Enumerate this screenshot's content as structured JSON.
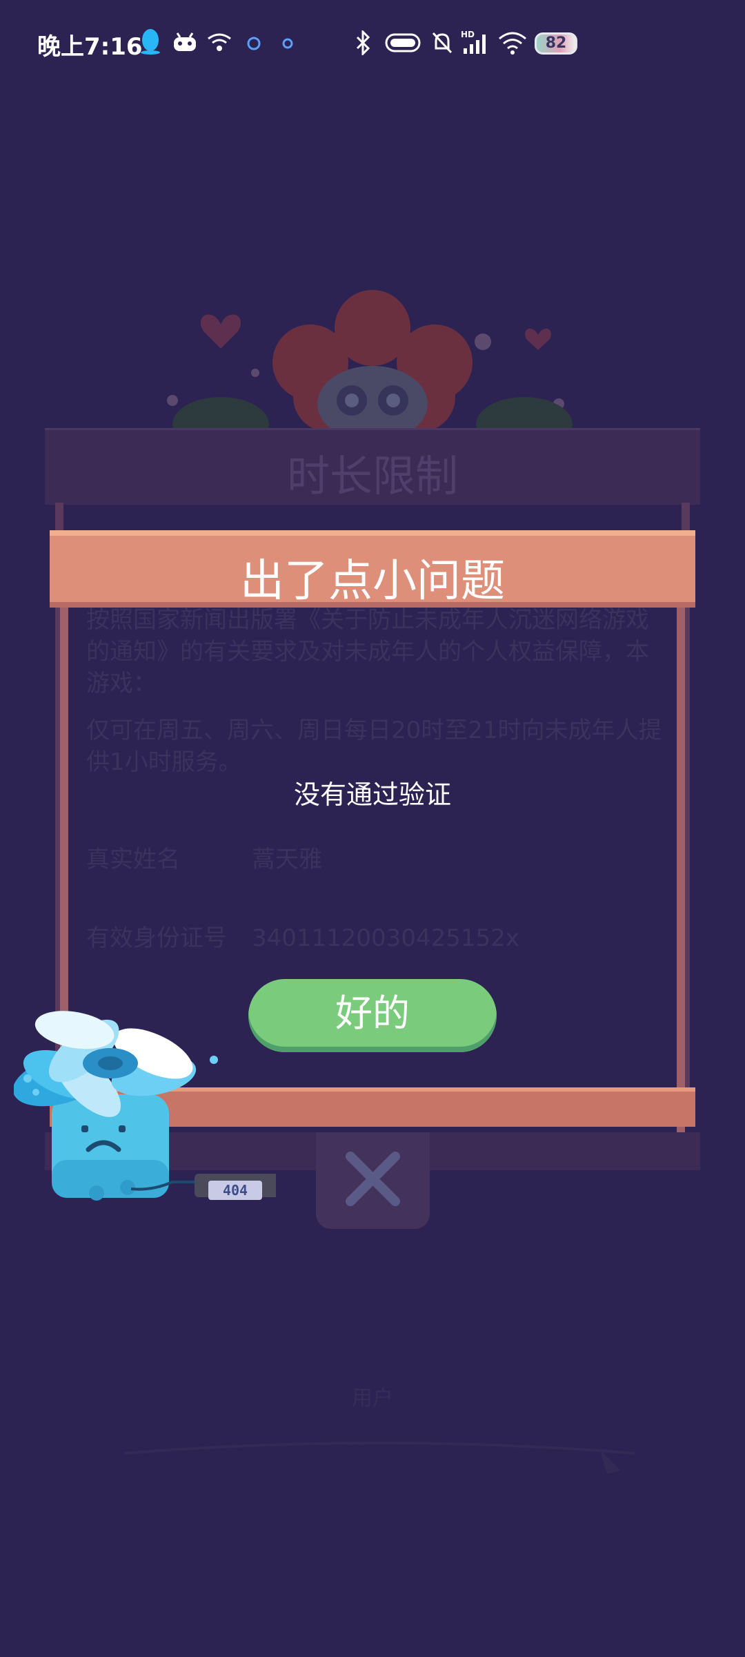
{
  "status_bar": {
    "time": "晚上7:16",
    "icons": [
      "qq-icon",
      "android-icon",
      "wifi-calling-icon",
      "app-icon",
      "app-icon",
      "bluetooth-icon",
      "toggle-icon",
      "mute-bell-icon",
      "hd-signal-icon",
      "wifi-icon"
    ],
    "battery_level": "82"
  },
  "background": {
    "panel_title": "时长限制",
    "lines": [
      "按照国家新闻出版署《关于防止未成年人沉迷网络游戏",
      "的通知》的有关要求及对未成年人的个人权益保障，本",
      "游戏：",
      "仅可在周五、周六、周日每日20时至21时向未成年人提",
      "供1小时服务。",
      "真实姓名",
      "蒿天雅",
      "有效身份证号",
      "340111200304251​52x"
    ],
    "footer": "用户"
  },
  "modal": {
    "title": "出了点小问题",
    "message": "没有通过验证",
    "ok_button": "好的"
  },
  "mascot": {
    "label": "404"
  },
  "colors": {
    "background": "#2c2352",
    "header": "#de8f7a",
    "ok_button": "#7acb7c",
    "mascot": "#4fc3e8"
  }
}
